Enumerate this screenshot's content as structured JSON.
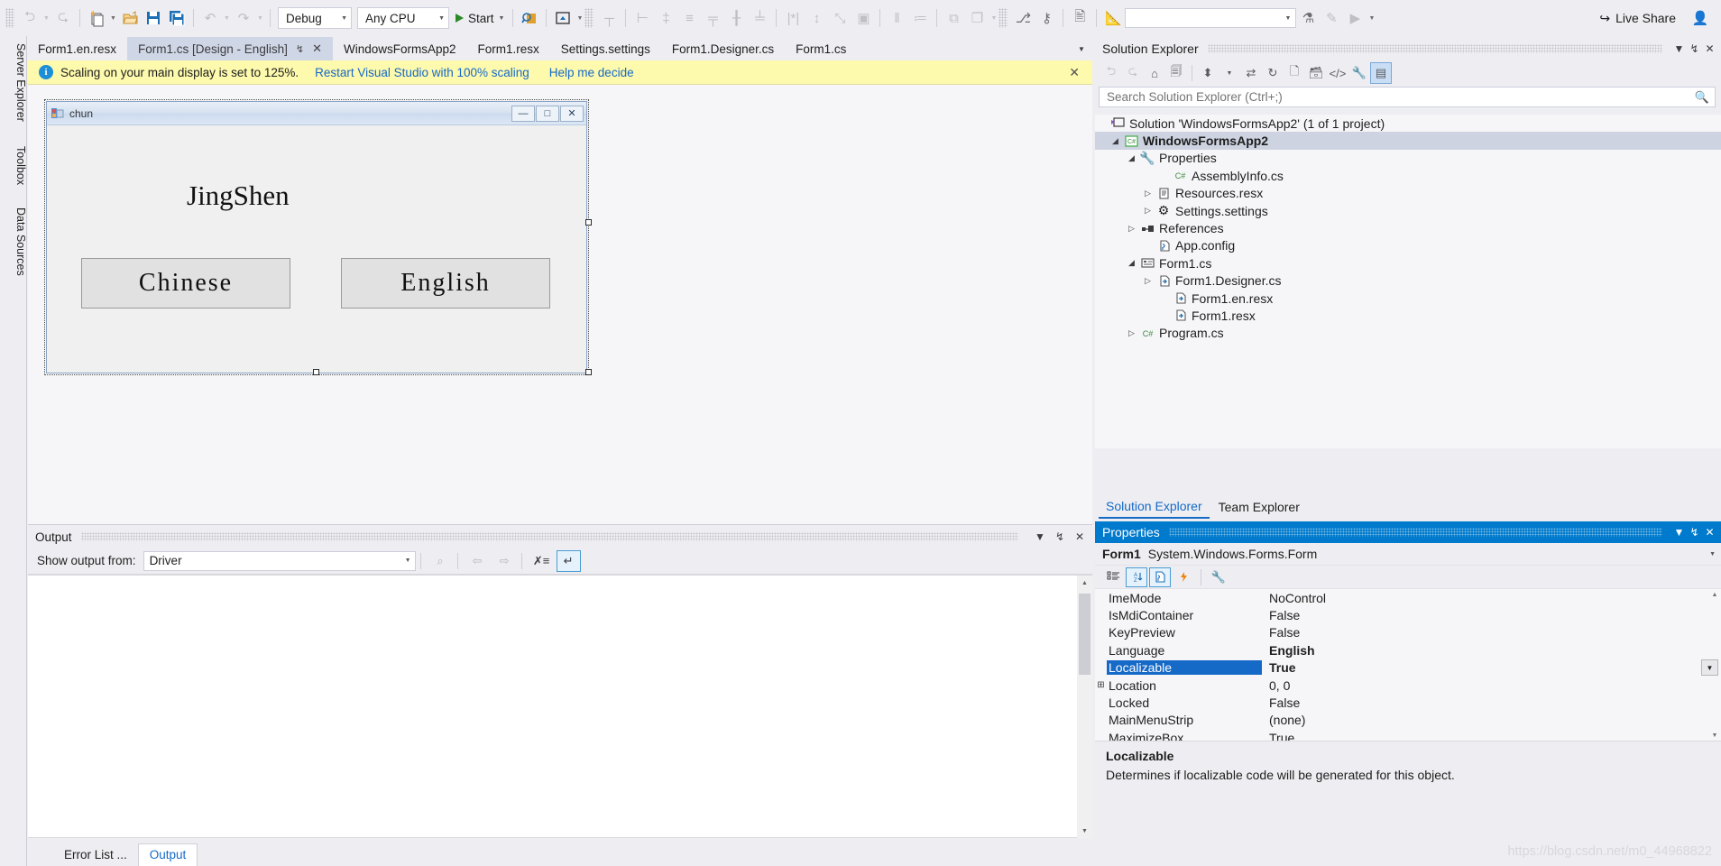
{
  "toolbar": {
    "nav_back_icon": "back-arrow-icon",
    "nav_forward_icon": "forward-arrow-icon",
    "new_item_icon": "new-item-icon",
    "open_file_icon": "open-file-icon",
    "save_icon": "save-icon",
    "save_all_icon": "save-all-icon",
    "undo_icon": "undo-icon",
    "redo_icon": "redo-icon",
    "config_value": "Debug",
    "platform_value": "Any CPU",
    "start_label": "Start",
    "find_icon": "find-icon",
    "preview_icon": "preview-home-icon",
    "search_placeholder": "",
    "live_share_label": "Live Share",
    "live_share_icon": "share-icon",
    "account_icon": "account-icon"
  },
  "left_dock": {
    "items": [
      {
        "label": "Server Explorer"
      },
      {
        "label": "Toolbox"
      },
      {
        "label": "Data Sources"
      }
    ]
  },
  "tabs": [
    {
      "label": "Form1.en.resx",
      "active": false
    },
    {
      "label": "Form1.cs [Design - English]",
      "active": true
    },
    {
      "label": "WindowsFormsApp2",
      "active": false
    },
    {
      "label": "Form1.resx",
      "active": false
    },
    {
      "label": "Settings.settings",
      "active": false
    },
    {
      "label": "Form1.Designer.cs",
      "active": false
    },
    {
      "label": "Form1.cs",
      "active": false
    }
  ],
  "notice": {
    "icon": "info-icon",
    "text": "Scaling on your main display is set to 125%.",
    "link_restart": "Restart Visual Studio with 100% scaling",
    "link_help": "Help me decide",
    "close_icon": "close-icon"
  },
  "designer": {
    "form_title": "chun",
    "form_icon": "winform-icon",
    "minimize_icon": "minimize-icon",
    "maximize_icon": "maximize-icon",
    "close_icon": "close-icon",
    "label_text": "JingShen",
    "button_chinese": "Chinese",
    "button_english": "English"
  },
  "output": {
    "title": "Output",
    "dropdown_icon": "chevron-down-icon",
    "pin_icon": "pin-icon",
    "close_icon": "close-icon",
    "show_output_from_label": "Show output from:",
    "source_value": "Driver",
    "find_message_icon": "find-message-icon",
    "go_prev_icon": "go-to-previous-icon",
    "go_next_icon": "go-to-next-icon",
    "clear_all_icon": "clear-all-icon",
    "word_wrap_icon": "toggle-word-wrap-icon",
    "content": "",
    "tabs": [
      {
        "label": "Error List ...",
        "active": false
      },
      {
        "label": "Output",
        "active": true
      }
    ]
  },
  "solution_explorer": {
    "title": "Solution Explorer",
    "dropdown_icon": "chevron-down-icon",
    "pin_icon": "pin-icon",
    "close_icon": "close-icon",
    "toolbar": {
      "back_icon": "back-arrow-icon",
      "forward_icon": "forward-arrow-icon",
      "home_icon": "home-icon",
      "pending_changes_icon": "pending-changes-icon",
      "collapse_icon": "collapse-all-icon",
      "sync_icon": "sync-with-active-document-icon",
      "refresh_icon": "refresh-icon",
      "show_all_files_icon": "show-all-files-icon",
      "properties_icon": "properties-icon",
      "code_icon": "view-code-icon",
      "wrench_icon": "wrench-icon",
      "designer_icon": "view-designer-icon"
    },
    "search_placeholder": "Search Solution Explorer (Ctrl+;)",
    "search_value": "",
    "search_icon": "search-icon",
    "tree": [
      {
        "label": "Solution 'WindowsFormsApp2' (1 of 1 project)",
        "indent": 0,
        "arrow": "none",
        "icon": "solution-icon",
        "bold": false,
        "selected": false
      },
      {
        "label": "WindowsFormsApp2",
        "indent": 1,
        "arrow": "open",
        "icon": "csharp-project-icon",
        "bold": true,
        "selected": true
      },
      {
        "label": "Properties",
        "indent": 2,
        "arrow": "open",
        "icon": "wrench-icon",
        "bold": false,
        "selected": false
      },
      {
        "label": "AssemblyInfo.cs",
        "indent": 4,
        "arrow": "none",
        "icon": "csharp-file-icon",
        "bold": false,
        "selected": false
      },
      {
        "label": "Resources.resx",
        "indent": 3,
        "arrow": "closed",
        "icon": "resx-icon",
        "bold": false,
        "selected": false
      },
      {
        "label": "Settings.settings",
        "indent": 3,
        "arrow": "closed",
        "icon": "settings-icon",
        "bold": false,
        "selected": false
      },
      {
        "label": "References",
        "indent": 2,
        "arrow": "closed",
        "icon": "references-icon",
        "bold": false,
        "selected": false
      },
      {
        "label": "App.config",
        "indent": 3,
        "arrow": "none",
        "icon": "config-file-icon",
        "bold": false,
        "selected": false
      },
      {
        "label": "Form1.cs",
        "indent": 2,
        "arrow": "open",
        "icon": "form-icon",
        "bold": false,
        "selected": false
      },
      {
        "label": "Form1.Designer.cs",
        "indent": 3,
        "arrow": "closed",
        "icon": "designer-file-icon",
        "bold": false,
        "selected": false
      },
      {
        "label": "Form1.en.resx",
        "indent": 4,
        "arrow": "none",
        "icon": "designer-file-icon",
        "bold": false,
        "selected": false
      },
      {
        "label": "Form1.resx",
        "indent": 4,
        "arrow": "none",
        "icon": "designer-file-icon",
        "bold": false,
        "selected": false
      },
      {
        "label": "Program.cs",
        "indent": 2,
        "arrow": "closed",
        "icon": "csharp-file-icon",
        "bold": false,
        "selected": false
      }
    ],
    "tabs": [
      {
        "label": "Solution Explorer",
        "active": true
      },
      {
        "label": "Team Explorer",
        "active": false
      }
    ]
  },
  "properties": {
    "title": "Properties",
    "dropdown_icon": "chevron-down-icon",
    "pin_icon": "pin-icon",
    "close_icon": "close-icon",
    "object_name": "Form1",
    "object_type": "System.Windows.Forms.Form",
    "object_caret_icon": "chevron-down-icon",
    "toolbar": {
      "categorized_icon": "categorized-icon",
      "alphabetical_icon": "alphabetical-sort-icon",
      "properties_icon": "properties-page-icon",
      "events_icon": "events-lightning-icon",
      "property_pages_icon": "property-pages-icon"
    },
    "rows": [
      {
        "name": "ImeMode",
        "value": "NoControl",
        "expandable": false,
        "selected": false,
        "bold": false
      },
      {
        "name": "IsMdiContainer",
        "value": "False",
        "expandable": false,
        "selected": false,
        "bold": false
      },
      {
        "name": "KeyPreview",
        "value": "False",
        "expandable": false,
        "selected": false,
        "bold": false
      },
      {
        "name": "Language",
        "value": "English",
        "expandable": false,
        "selected": false,
        "bold": true
      },
      {
        "name": "Localizable",
        "value": "True",
        "expandable": false,
        "selected": true,
        "bold": true
      },
      {
        "name": "Location",
        "value": "0, 0",
        "expandable": true,
        "selected": false,
        "bold": false
      },
      {
        "name": "Locked",
        "value": "False",
        "expandable": false,
        "selected": false,
        "bold": false
      },
      {
        "name": "MainMenuStrip",
        "value": "(none)",
        "expandable": false,
        "selected": false,
        "bold": false
      },
      {
        "name": "MaximizeBox",
        "value": "True",
        "expandable": false,
        "selected": false,
        "bold": false
      }
    ],
    "description_title": "Localizable",
    "description_text": "Determines if localizable code will be generated for this object.",
    "watermark": "https://blog.csdn.net/m0_44968822"
  },
  "colors": {
    "accent": "#007acc",
    "link": "#1569c7",
    "notice_bg": "#fdf9ad",
    "selection": "#cdd3e0",
    "chrome": "#eeeef2"
  }
}
